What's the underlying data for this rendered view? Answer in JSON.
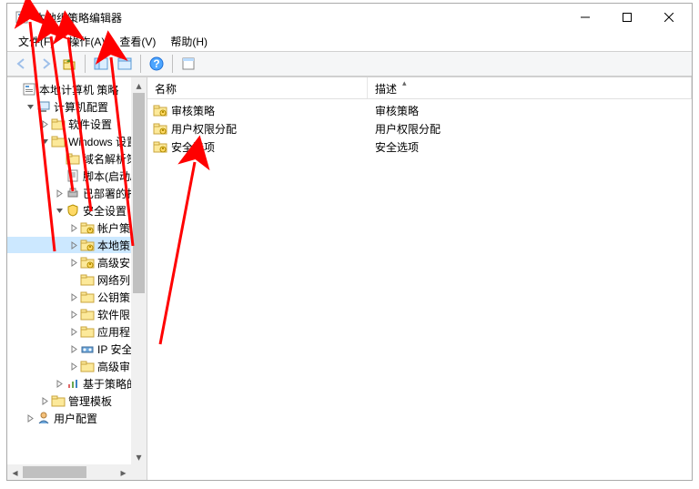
{
  "window": {
    "title": "本地组策略编辑器"
  },
  "menubar": {
    "file": "文件(F)",
    "action": "操作(A)",
    "view": "查看(V)",
    "help": "帮助(H)"
  },
  "tree": {
    "root": "本地计算机 策略",
    "items": [
      {
        "label": "计算机配置",
        "level": 1,
        "expander": "open",
        "icon": "computer"
      },
      {
        "label": "软件设置",
        "level": 2,
        "expander": "closed",
        "icon": "folder"
      },
      {
        "label": "Windows 设置",
        "level": 2,
        "expander": "open",
        "icon": "folder"
      },
      {
        "label": "域名解析策",
        "level": 3,
        "expander": "none",
        "icon": "folder"
      },
      {
        "label": "脚本(启动/",
        "level": 3,
        "expander": "none",
        "icon": "script"
      },
      {
        "label": "已部署的打",
        "level": 3,
        "expander": "closed",
        "icon": "printer"
      },
      {
        "label": "安全设置",
        "level": 3,
        "expander": "open",
        "icon": "security"
      },
      {
        "label": "帐户策",
        "level": 4,
        "expander": "closed",
        "icon": "folder-sec"
      },
      {
        "label": "本地策",
        "level": 4,
        "expander": "closed",
        "icon": "folder-sec",
        "selected": true
      },
      {
        "label": "高级安",
        "level": 4,
        "expander": "closed",
        "icon": "folder-sec"
      },
      {
        "label": "网络列",
        "level": 4,
        "expander": "none",
        "icon": "folder"
      },
      {
        "label": "公钥策",
        "level": 4,
        "expander": "closed",
        "icon": "folder"
      },
      {
        "label": "软件限",
        "level": 4,
        "expander": "closed",
        "icon": "folder"
      },
      {
        "label": "应用程",
        "level": 4,
        "expander": "closed",
        "icon": "folder"
      },
      {
        "label": "IP 安全",
        "level": 4,
        "expander": "closed",
        "icon": "ipsec"
      },
      {
        "label": "高级审",
        "level": 4,
        "expander": "closed",
        "icon": "folder"
      },
      {
        "label": "基于策略的",
        "level": 3,
        "expander": "closed",
        "icon": "chart"
      },
      {
        "label": "管理模板",
        "level": 2,
        "expander": "closed",
        "icon": "folder"
      },
      {
        "label": "用户配置",
        "level": 1,
        "expander": "closed",
        "icon": "user"
      }
    ]
  },
  "list": {
    "col1": "名称",
    "col2": "描述",
    "rows": [
      {
        "name": "审核策略",
        "desc": "审核策略"
      },
      {
        "name": "用户权限分配",
        "desc": "用户权限分配"
      },
      {
        "name": "安全选项",
        "desc": "安全选项"
      }
    ]
  },
  "colors": {
    "arrow": "#ff0000",
    "selection": "#cce8ff"
  }
}
